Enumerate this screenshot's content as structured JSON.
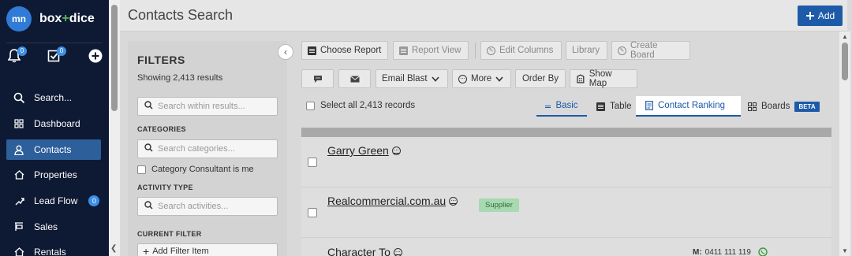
{
  "nav": {
    "logo_text": "mn",
    "brand_left": "box",
    "brand_plus": "+",
    "brand_right": "dice",
    "notif_badge": "0",
    "tasks_badge": "0",
    "items": [
      {
        "label": "Search...",
        "icon": "search-icon"
      },
      {
        "label": "Dashboard",
        "icon": "grid-icon"
      },
      {
        "label": "Contacts",
        "icon": "person-icon",
        "active": true
      },
      {
        "label": "Properties",
        "icon": "house-icon"
      },
      {
        "label": "Lead Flow",
        "icon": "flow-icon",
        "count": "0"
      },
      {
        "label": "Sales",
        "icon": "sign-icon"
      },
      {
        "label": "Rentals",
        "icon": "house-icon"
      }
    ]
  },
  "header": {
    "title": "Contacts Search",
    "add_label": "Add"
  },
  "filters": {
    "title": "FILTERS",
    "count_text": "Showing 2,413 results",
    "search_placeholder": "Search within results...",
    "categories_label": "CATEGORIES",
    "categories_placeholder": "Search categories...",
    "consultant_check": "Category Consultant is me",
    "activity_label": "ACTIVITY TYPE",
    "activity_placeholder": "Search activities...",
    "current_label": "CURRENT FILTER",
    "add_filter": "Add Filter Item"
  },
  "toolbar": {
    "choose_report": "Choose Report",
    "report_view": "Report View",
    "edit_columns": "Edit Columns",
    "library": "Library",
    "create_board": "Create Board",
    "email_blast": "Email Blast",
    "more": "More",
    "order_by": "Order By",
    "show_map": "Show Map"
  },
  "views": {
    "select_all": "Select all 2,413 records",
    "basic": "Basic",
    "table": "Table",
    "ranking": "Contact Ranking",
    "boards": "Boards",
    "beta": "BETA"
  },
  "contacts": [
    {
      "name": "Garry Green"
    },
    {
      "name": "Realcommercial.com.au",
      "tag": "Supplier"
    },
    {
      "name": "Character To",
      "phone_label": "M:",
      "phone": "0411 111 119"
    }
  ],
  "colors": {
    "nav_bg": "#0e1a33",
    "accent": "#1d5ba8",
    "active_nav": "#2d5f9a",
    "supplier_tag": "#a8d9b0"
  }
}
